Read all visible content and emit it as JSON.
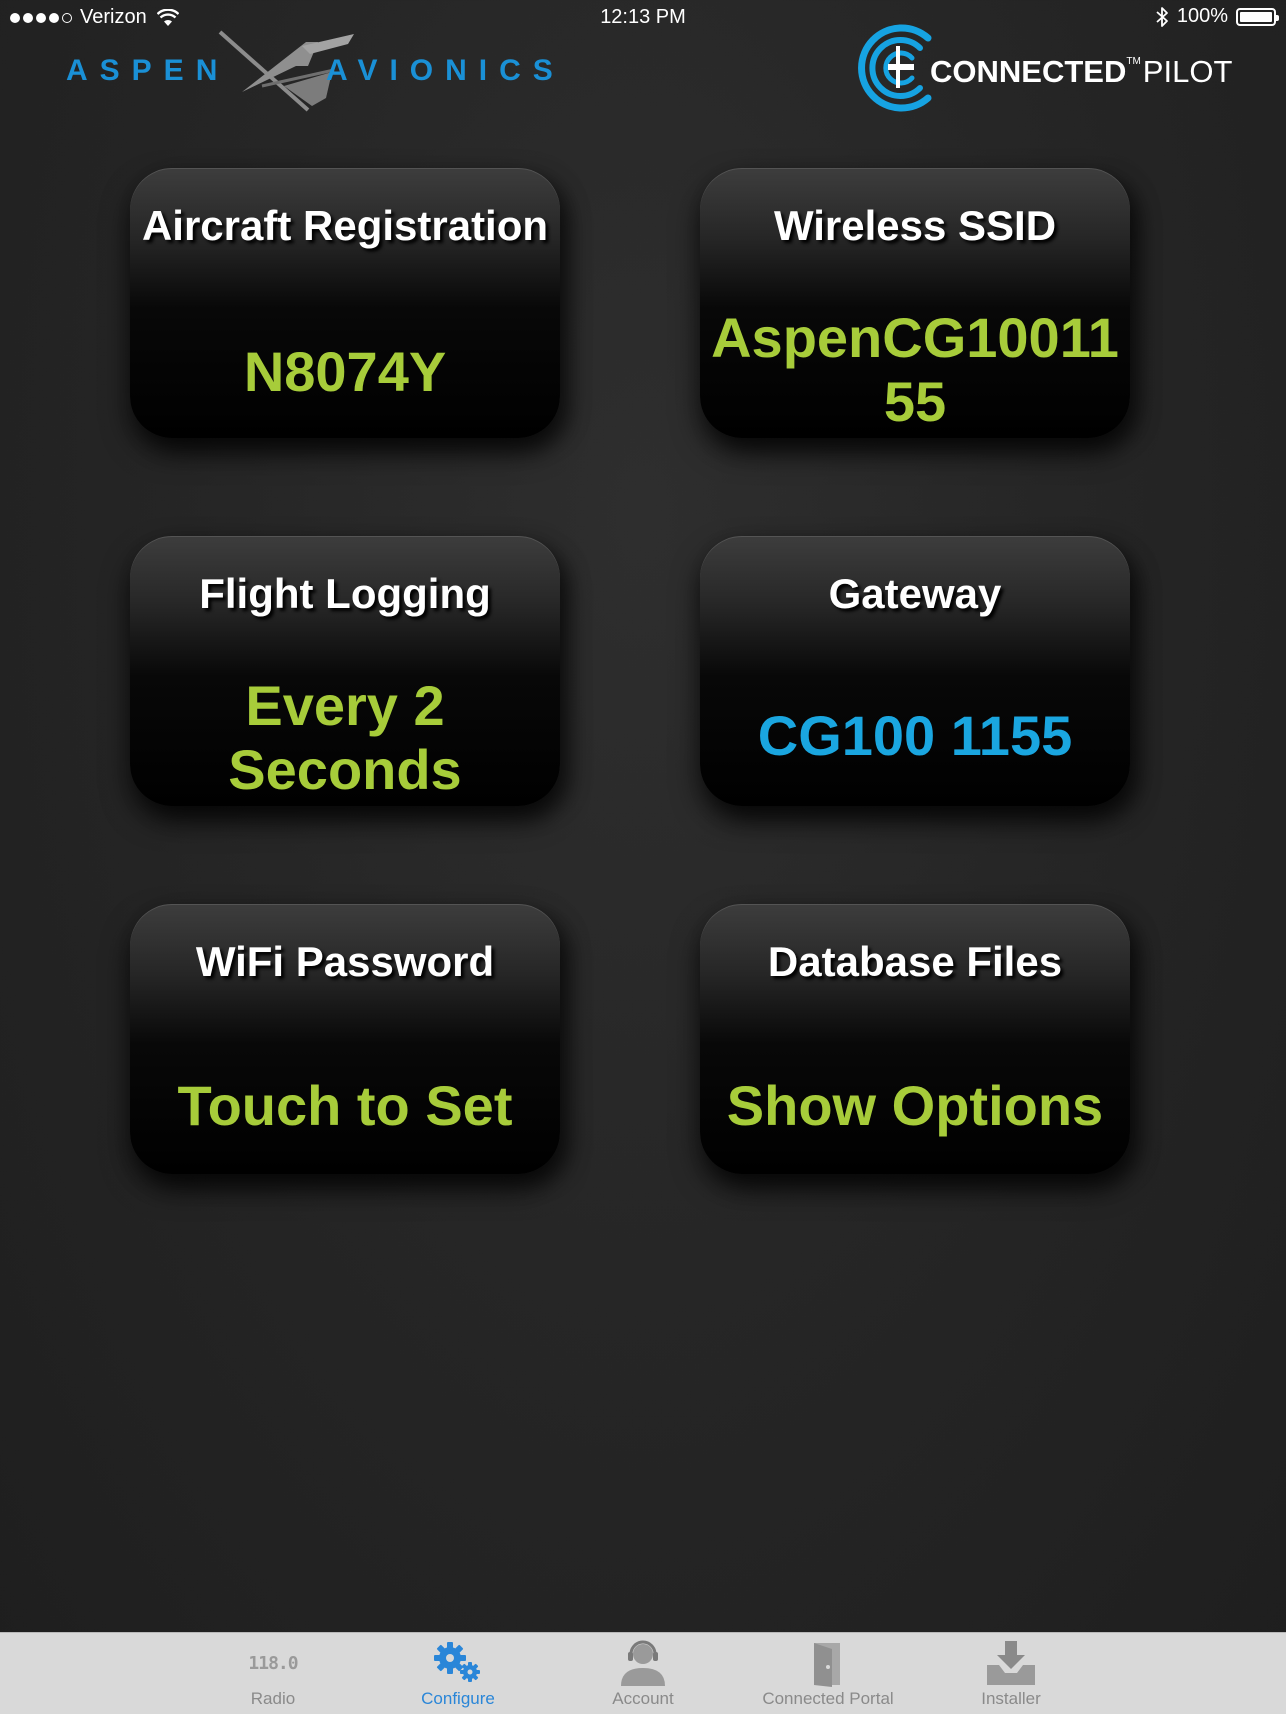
{
  "status_bar": {
    "carrier": "Verizon",
    "time": "12:13 PM",
    "battery": "100%"
  },
  "logos": {
    "aspen_left": "ASPEN",
    "aspen_right": "AVIONICS",
    "cp_connected": "CONNECTED",
    "cp_tm": "TM",
    "cp_pilot": "PILOT"
  },
  "colors": {
    "value_green": "#a7cc3a",
    "value_blue": "#1aa6e0",
    "accent_blue": "#2a86d8"
  },
  "tiles": [
    {
      "title": "Aircraft Registration",
      "value": "N8074Y",
      "value_color": "green"
    },
    {
      "title": "Wireless SSID",
      "value": "AspenCG10011\n55",
      "value_color": "green"
    },
    {
      "title": "Flight Logging",
      "value": "Every 2\nSeconds",
      "value_color": "green"
    },
    {
      "title": "Gateway",
      "value": "CG100 1155",
      "value_color": "blue"
    },
    {
      "title": "WiFi Password",
      "value": "Touch to Set",
      "value_color": "green"
    },
    {
      "title": "Database Files",
      "value": "Show Options",
      "value_color": "green"
    }
  ],
  "tab_bar": {
    "radio_digits": "118.0",
    "tabs": [
      {
        "label": "Radio",
        "icon": "radio-frequency-icon",
        "active": false
      },
      {
        "label": "Configure",
        "icon": "gears-icon",
        "active": true
      },
      {
        "label": "Account",
        "icon": "headset-person-icon",
        "active": false
      },
      {
        "label": "Connected Portal",
        "icon": "door-icon",
        "active": false
      },
      {
        "label": "Installer",
        "icon": "download-tray-icon",
        "active": false
      }
    ]
  }
}
